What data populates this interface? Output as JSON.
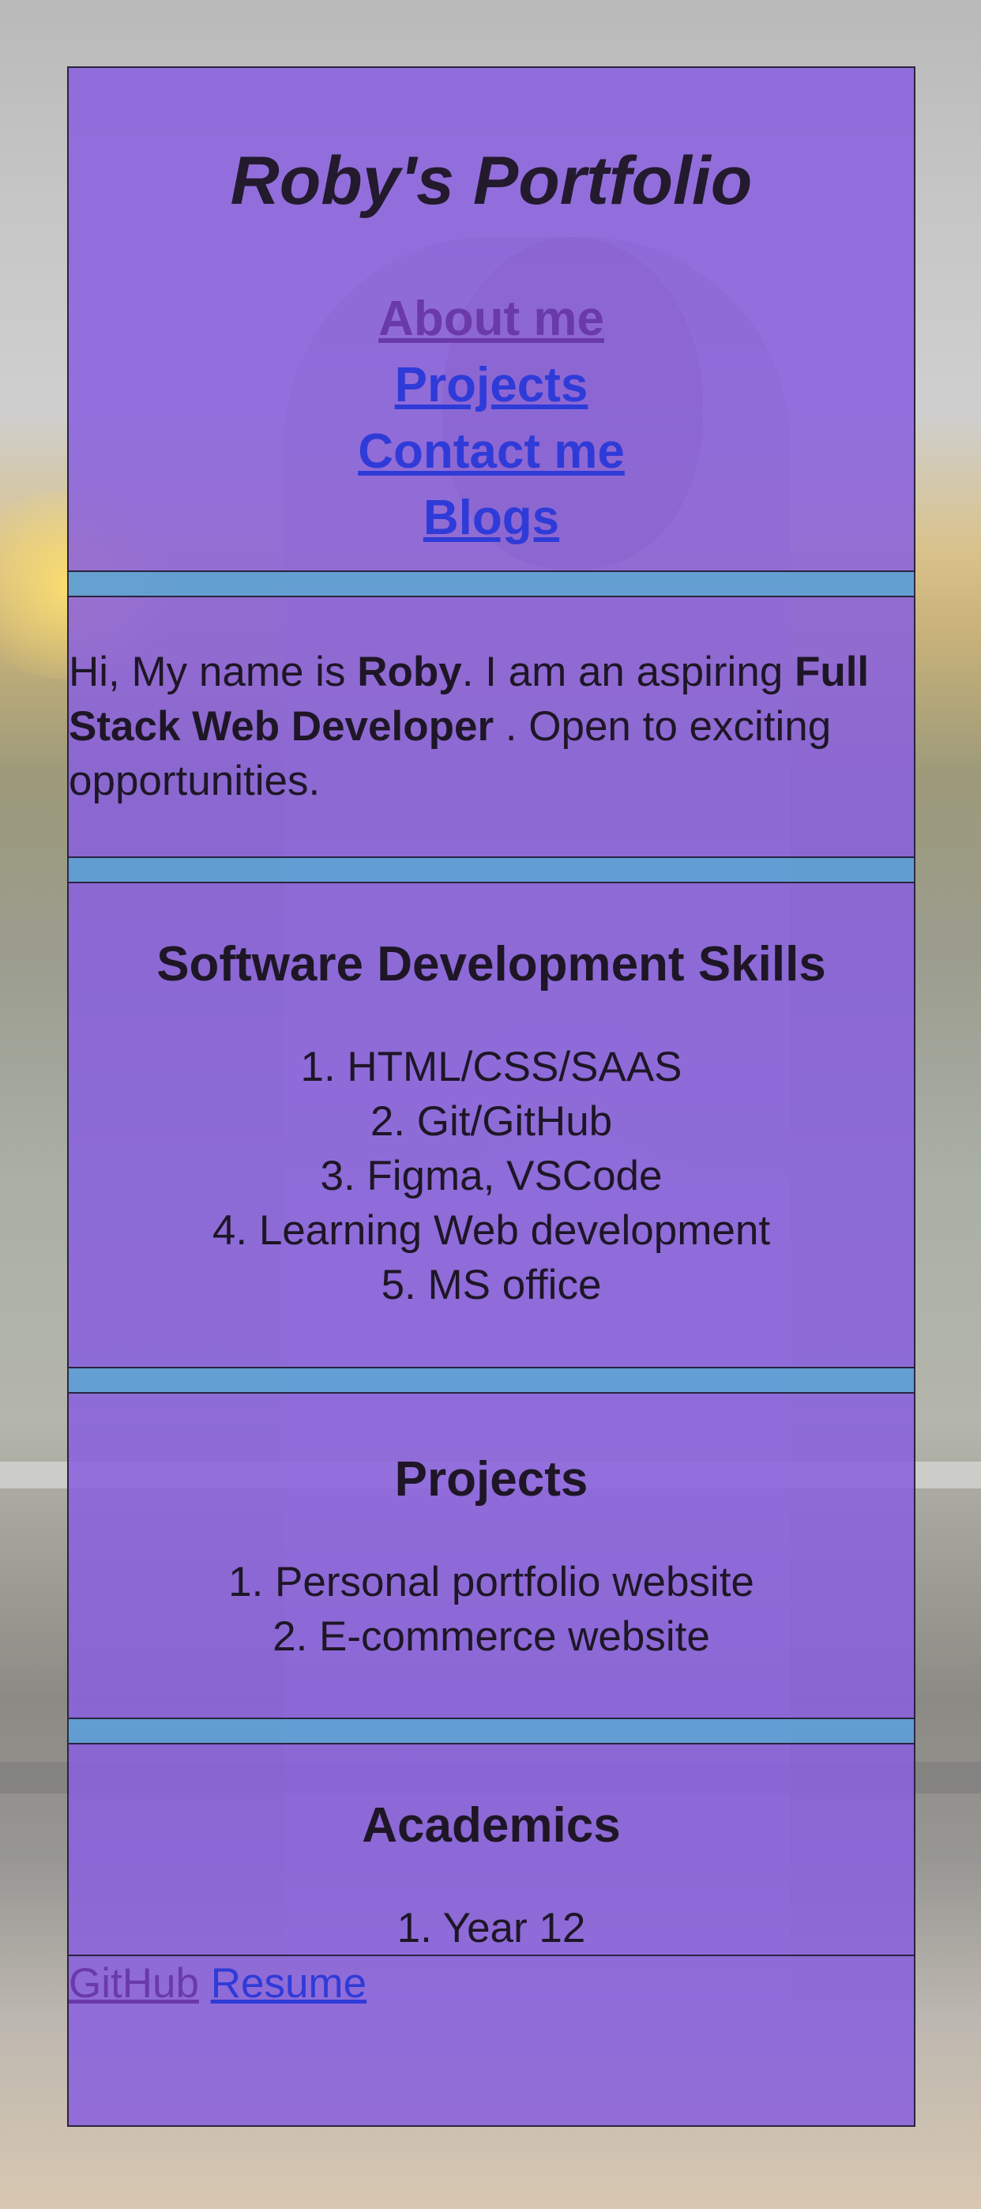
{
  "header": {
    "title": "Roby's Portfolio",
    "nav": [
      {
        "label": "About me",
        "visited": true
      },
      {
        "label": "Projects",
        "visited": false
      },
      {
        "label": "Contact me",
        "visited": false
      },
      {
        "label": "Blogs",
        "visited": false
      }
    ]
  },
  "intro": {
    "pre": "Hi, My name is ",
    "name": "Roby",
    "mid": ". I am an aspiring ",
    "role": "Full Stack Web Developer",
    "post": " . Open to exciting opportunities."
  },
  "skills": {
    "heading": "Software Development Skills",
    "items": [
      "1. HTML/CSS/SAAS",
      "2. Git/GitHub",
      "3. Figma, VSCode",
      "4. Learning Web development",
      "5. MS office"
    ]
  },
  "projects": {
    "heading": "Projects",
    "items": [
      "1. Personal portfolio website",
      "2. E-commerce website"
    ]
  },
  "academics": {
    "heading": "Academics",
    "items": [
      "1. Year 12"
    ]
  },
  "footer": {
    "links": [
      {
        "label": "GitHub",
        "visited": true
      },
      {
        "label": "Resume",
        "visited": false
      }
    ]
  },
  "colors": {
    "card": "#8860de",
    "divider": "#5f9ed6",
    "link": "#2f3bd8",
    "visited_link": "#6a3aa8"
  }
}
